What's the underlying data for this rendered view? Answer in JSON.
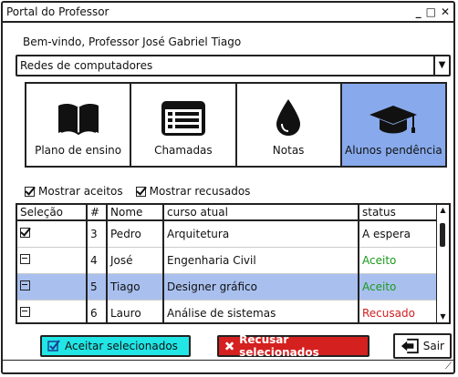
{
  "window": {
    "title": "Portal do Professor",
    "controls": [
      "_",
      "□",
      "✕"
    ]
  },
  "welcome": "Bem-vindo, Professor José Gabriel Tiago",
  "course_select": {
    "value": "Redes de computadores"
  },
  "tiles": [
    {
      "label": "Plano de ensino",
      "icon": "open-book-icon",
      "active": false
    },
    {
      "label": "Chamadas",
      "icon": "list-icon",
      "active": false
    },
    {
      "label": "Notas",
      "icon": "drop-icon",
      "active": false
    },
    {
      "label": "Alunos pendência",
      "icon": "graduation-cap-icon",
      "active": true
    }
  ],
  "filters": {
    "show_accepted": {
      "label": "Mostrar aceitos",
      "checked": true
    },
    "show_rejected": {
      "label": "Mostrar recusados",
      "checked": true
    }
  },
  "table": {
    "columns": [
      "Seleção",
      "#",
      "Nome",
      "curso atual",
      "status"
    ],
    "rows": [
      {
        "selection": "checked",
        "num": "3",
        "name": "Pedro",
        "course": "Arquitetura",
        "status": "A espera",
        "status_type": "waiting",
        "selected": false
      },
      {
        "selection": "partial",
        "num": "4",
        "name": "José",
        "course": "Engenharia Civil",
        "status": "Aceito",
        "status_type": "accepted",
        "selected": false
      },
      {
        "selection": "partial",
        "num": "5",
        "name": "Tiago",
        "course": "Designer gráfico",
        "status": "Aceito",
        "status_type": "accepted",
        "selected": true
      },
      {
        "selection": "partial",
        "num": "6",
        "name": "Lauro",
        "course": "Análise de sistemas",
        "status": "Recusado",
        "status_type": "rejected",
        "selected": false
      }
    ]
  },
  "buttons": {
    "accept": "Aceitar selecionados",
    "reject": "Recusar selecionados",
    "exit": "Sair"
  },
  "colors": {
    "tile_active": "#88aaec",
    "row_selected": "#a9c0ef",
    "accept_button": "#22e5e5",
    "reject_button": "#d52020",
    "status_accepted": "#1a9a1a",
    "status_rejected": "#d12020"
  }
}
